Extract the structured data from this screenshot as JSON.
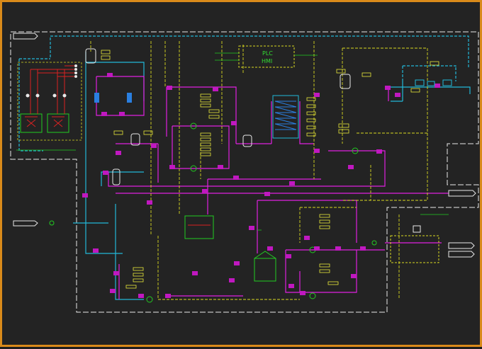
{
  "title_block": "",
  "plc_panel": {
    "line1": "PLC",
    "line2": "HMI"
  },
  "colors": {
    "frame": "#d98a1a",
    "background": "#232323",
    "process_magenta": "#e020e0",
    "cyan_line": "#22b8d8",
    "yellow_dashed": "#d8d820",
    "green_equipment": "#22cc22",
    "white_border": "#e8e8e8",
    "tag_label": "#e8e83a",
    "blue_filter": "#2a7fe0",
    "red_line": "#d82222"
  },
  "equipment": {
    "chiller_units": [
      "unit-1",
      "unit-2"
    ],
    "plate_heat_exchanger": "plate-hx",
    "storage_tank": "tank-1",
    "reaction_tank": "tank-2",
    "control_box": "control-panel"
  }
}
